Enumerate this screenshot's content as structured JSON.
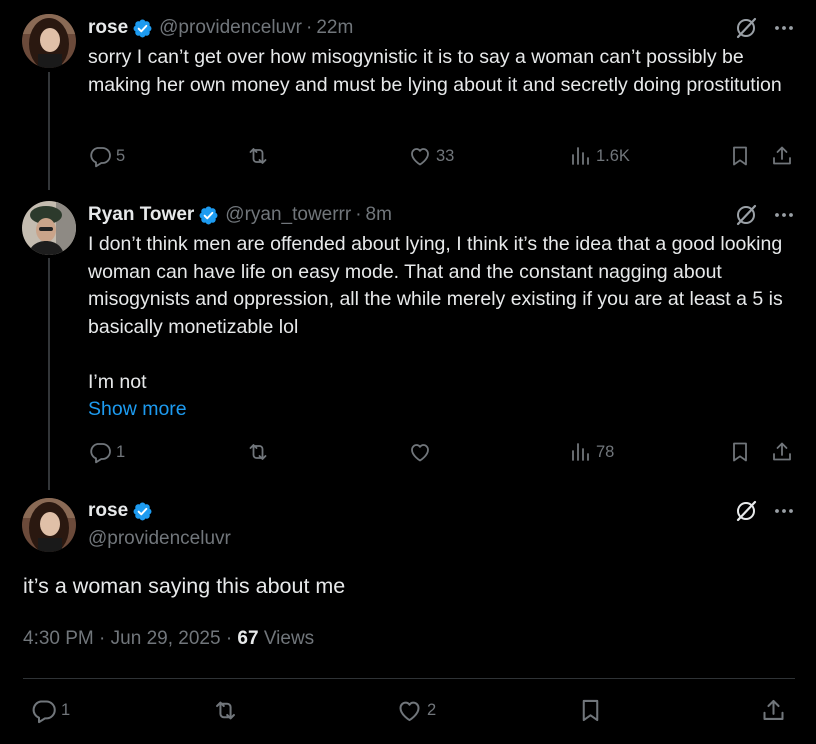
{
  "colors": {
    "background": "#000000",
    "text": "#e7e9ea",
    "muted": "#71767b",
    "accent": "#1d9bf0",
    "verified": "#1d9bf0"
  },
  "post1": {
    "name": "rose",
    "handle": "@providenceluvr",
    "sep": "·",
    "time": "22m",
    "text": "sorry I can’t get over how misogynistic it is to say a woman can’t possibly be making her own money and must be lying about it and secretly doing prostitution",
    "replies": "5",
    "reposts": "",
    "likes": "33",
    "views": "1.6K"
  },
  "post2": {
    "name": "Ryan Tower",
    "handle": "@ryan_towerrr",
    "sep": "·",
    "time": "8m",
    "text": "I don’t think men are offended about lying, I think it’s the idea that a good looking woman can have life on easy mode. That and the constant nagging about misogynists and oppression, all the while merely existing if you are at least a 5 is basically monetizable lol",
    "text2": "I’m not",
    "show_more": "Show more",
    "replies": "1",
    "reposts": "",
    "likes": "",
    "views": "78"
  },
  "main": {
    "name": "rose",
    "handle": "@providenceluvr",
    "text": "it’s a woman saying this about me",
    "time": "4:30 PM",
    "sep": "·",
    "date": "Jun 29, 2025",
    "sep2": "·",
    "views_count": "67",
    "views_label": "Views",
    "replies": "1",
    "reposts": "",
    "likes": "2"
  },
  "icons": {
    "reply": "reply-icon",
    "repost": "repost-icon",
    "like": "heart-icon",
    "views": "analytics-icon",
    "bookmark": "bookmark-icon",
    "share": "share-icon",
    "grok": "grok-icon",
    "more": "more-icon"
  }
}
